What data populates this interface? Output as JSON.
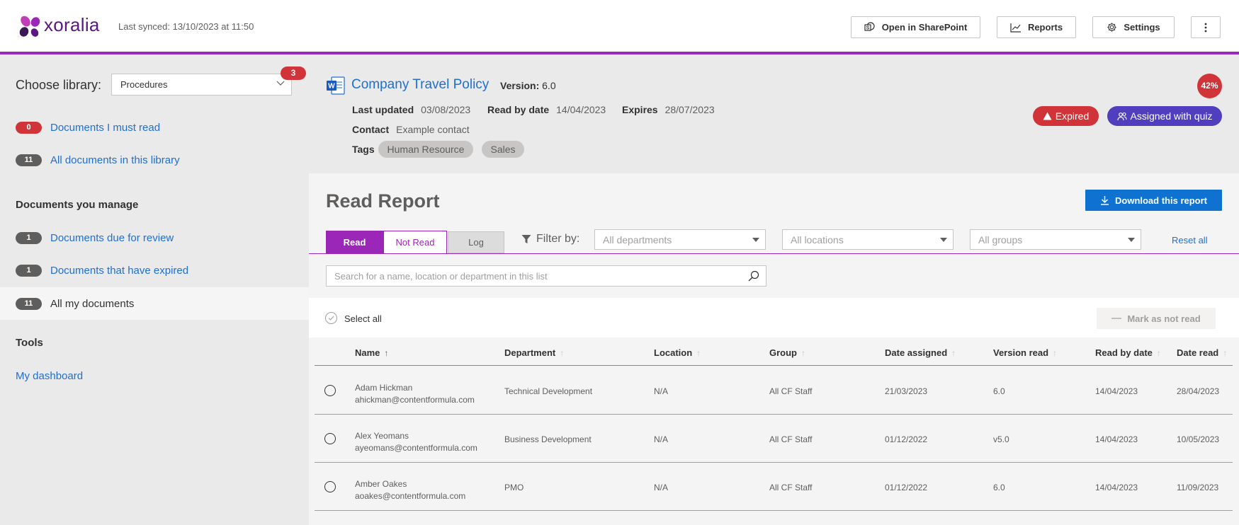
{
  "brand": {
    "name": "xoralia"
  },
  "sync_text": "Last synced: 13/10/2023 at 11:50",
  "toolbar": {
    "sharepoint": "Open in SharePoint",
    "reports": "Reports",
    "settings": "Settings"
  },
  "sidebar": {
    "choose_library_label": "Choose library:",
    "library_value": "Procedures",
    "library_badge": "3",
    "must_read": {
      "count": "0",
      "label": "Documents I must read"
    },
    "all_docs": {
      "count": "11",
      "label": "All documents in this library"
    },
    "manage_heading": "Documents you manage",
    "due_review": {
      "count": "1",
      "label": "Documents due for review"
    },
    "expired": {
      "count": "1",
      "label": "Documents that have expired"
    },
    "my_docs": {
      "count": "11",
      "label": "All my documents"
    },
    "tools_heading": "Tools",
    "dashboard": "My dashboard"
  },
  "document": {
    "title": "Company Travel Policy",
    "version_label": "Version:",
    "version_value": "6.0",
    "last_updated_label": "Last updated",
    "last_updated_value": "03/08/2023",
    "read_by_label": "Read by date",
    "read_by_value": "14/04/2023",
    "expires_label": "Expires",
    "expires_value": "28/07/2023",
    "contact_label": "Contact",
    "contact_value": "Example contact",
    "tags_label": "Tags",
    "tags": [
      "Human Resource",
      "Sales"
    ],
    "percent": "42%",
    "expired_badge": "Expired",
    "quiz_badge": "Assigned with quiz"
  },
  "report": {
    "title": "Read Report",
    "download": "Download this report",
    "tabs": [
      "Read",
      "Not Read",
      "Log"
    ],
    "filter_label": "Filter by:",
    "filters": [
      "All departments",
      "All locations",
      "All groups"
    ],
    "reset": "Reset all",
    "search_placeholder": "Search for a name, location or department in this list",
    "select_all": "Select all",
    "mark_not_read": "Mark as not read",
    "columns": [
      "Name",
      "Department",
      "Location",
      "Group",
      "Date assigned",
      "Version read",
      "Read by date",
      "Date read"
    ],
    "rows": [
      {
        "name": "Adam Hickman",
        "email": "ahickman@contentformula.com",
        "department": "Technical Development",
        "location": "N/A",
        "group": "All CF Staff",
        "date_assigned": "21/03/2023",
        "version_read": "6.0",
        "read_by": "14/04/2023",
        "date_read": "28/04/2023"
      },
      {
        "name": "Alex Yeomans",
        "email": "ayeomans@contentformula.com",
        "department": "Business Development",
        "location": "N/A",
        "group": "All CF Staff",
        "date_assigned": "01/12/2022",
        "version_read": "v5.0",
        "read_by": "14/04/2023",
        "date_read": "10/05/2023"
      },
      {
        "name": "Amber Oakes",
        "email": "aoakes@contentformula.com",
        "department": "PMO",
        "location": "N/A",
        "group": "All CF Staff",
        "date_assigned": "01/12/2022",
        "version_read": "6.0",
        "read_by": "14/04/2023",
        "date_read": "11/09/2023"
      }
    ]
  },
  "colors": {
    "accent": "#9b27b8",
    "link": "#1f6fd1",
    "danger": "#d13438",
    "quiz": "#4f3fbf",
    "primary_button": "#0f72d1"
  }
}
